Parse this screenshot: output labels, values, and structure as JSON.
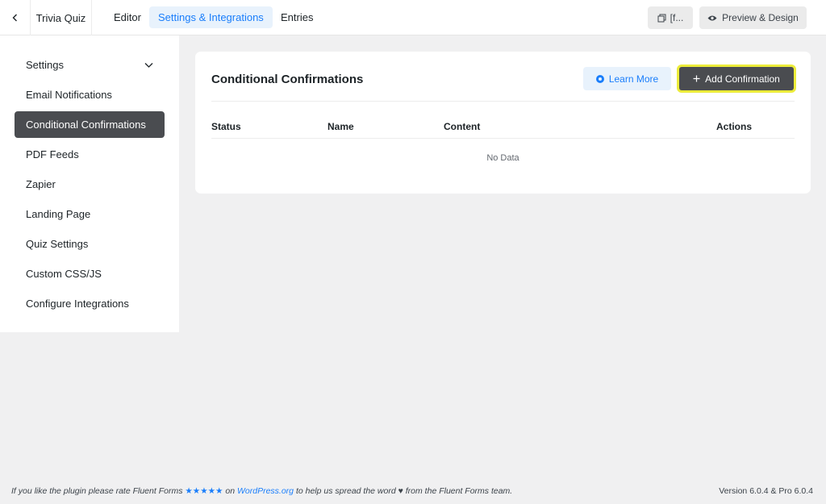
{
  "header": {
    "form_title": "Trivia Quiz",
    "tabs": [
      {
        "label": "Editor"
      },
      {
        "label": "Settings & Integrations",
        "active": true
      },
      {
        "label": "Entries"
      }
    ],
    "shortcode_label": "[f...",
    "preview_label": "Preview & Design"
  },
  "sidebar": {
    "items": [
      {
        "label": "Settings",
        "has_chevron": true
      },
      {
        "label": "Email Notifications"
      },
      {
        "label": "Conditional Confirmations",
        "active": true
      },
      {
        "label": "PDF Feeds"
      },
      {
        "label": "Zapier"
      },
      {
        "label": "Landing Page"
      },
      {
        "label": "Quiz Settings"
      },
      {
        "label": "Custom CSS/JS"
      },
      {
        "label": "Configure Integrations"
      }
    ]
  },
  "main": {
    "title": "Conditional Confirmations",
    "learn_more_label": "Learn More",
    "add_label": "Add Confirmation",
    "table": {
      "columns": [
        "Status",
        "Name",
        "Content",
        "Actions"
      ],
      "empty_text": "No Data"
    }
  },
  "footer": {
    "text_before": "If you like the plugin please rate Fluent Forms",
    "stars": "★★★★★",
    "text_on": "on",
    "link_text": "WordPress.org",
    "text_after": "to help us spread the word",
    "heart": "♥",
    "text_end": "from the Fluent Forms team.",
    "version": "Version 6.0.4 & Pro 6.0.4"
  },
  "colors": {
    "accent": "#1a7efb",
    "active_dark": "#4a4c50",
    "highlight": "#ecec3a",
    "background": "#f0f0f1"
  }
}
